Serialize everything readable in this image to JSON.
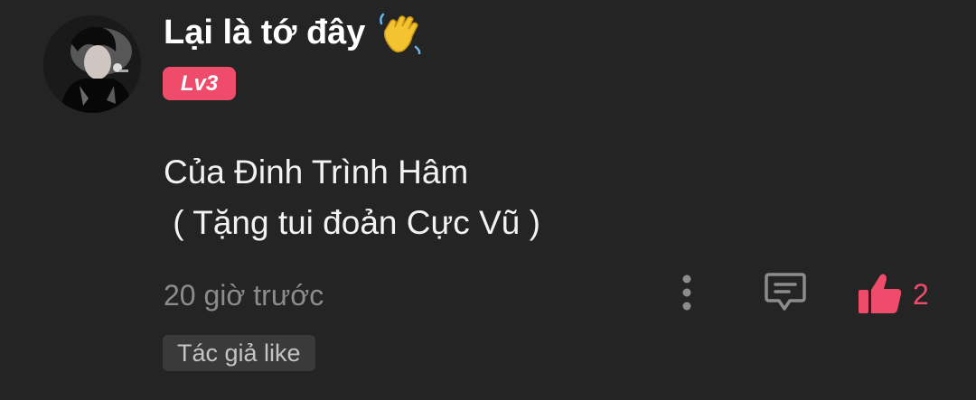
{
  "user": {
    "name": "Lại là tớ đây",
    "emoji_icon": "waving-hand-icon",
    "level": "Lv3",
    "level_color": "#ee4c6a"
  },
  "comment": {
    "lines": [
      "Của Đinh Trình Hâm",
      " ( Tặng tui đoản Cực Vũ )"
    ],
    "timestamp": "20 giờ trước"
  },
  "actions": {
    "more_icon": "more-vertical-icon",
    "reply_icon": "comment-reply-icon",
    "like_icon": "thumbs-up-icon",
    "like_count": "2",
    "like_color": "#ee4c6a"
  },
  "tag": {
    "author_like": "Tác giả like"
  }
}
